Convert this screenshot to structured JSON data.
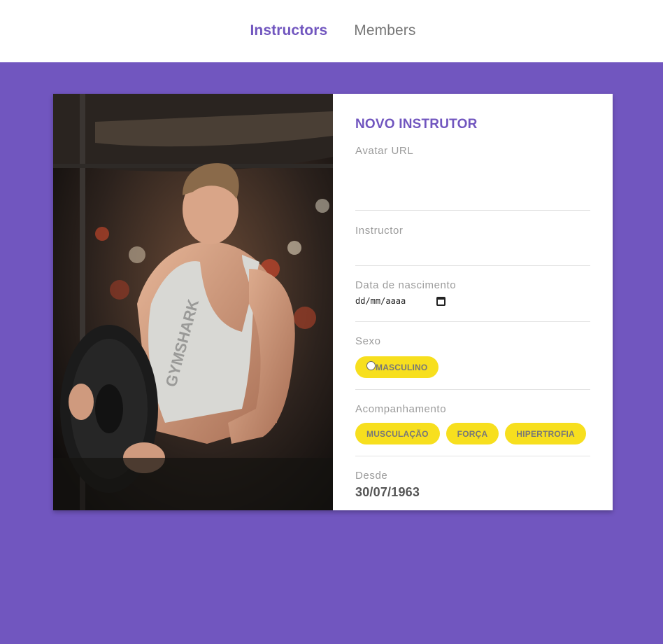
{
  "nav": {
    "items": [
      {
        "label": "Instructors",
        "active": true
      },
      {
        "label": "Members",
        "active": false
      }
    ]
  },
  "colors": {
    "primary": "#7156bf",
    "accent": "#f7df1e",
    "muted_text": "#9b9b9b"
  },
  "card": {
    "photo": {
      "description_icon": "instructor-photo"
    },
    "title": "NOVO INSTRUTOR",
    "avatar_url": {
      "label": "Avatar URL",
      "value": ""
    },
    "instructor": {
      "label": "Instructor",
      "value": ""
    },
    "birth": {
      "label": "Data de nascimento",
      "placeholder": "dd/mm/aaaa"
    },
    "sexo": {
      "label": "Sexo",
      "option": "MASCULINO"
    },
    "acompanhamento": {
      "label": "Acompanhamento",
      "tags": [
        "MUSCULAÇÃO",
        "FORÇA",
        "HIPERTROFIA"
      ]
    },
    "desde": {
      "label": "Desde",
      "value": "30/07/1963"
    }
  }
}
